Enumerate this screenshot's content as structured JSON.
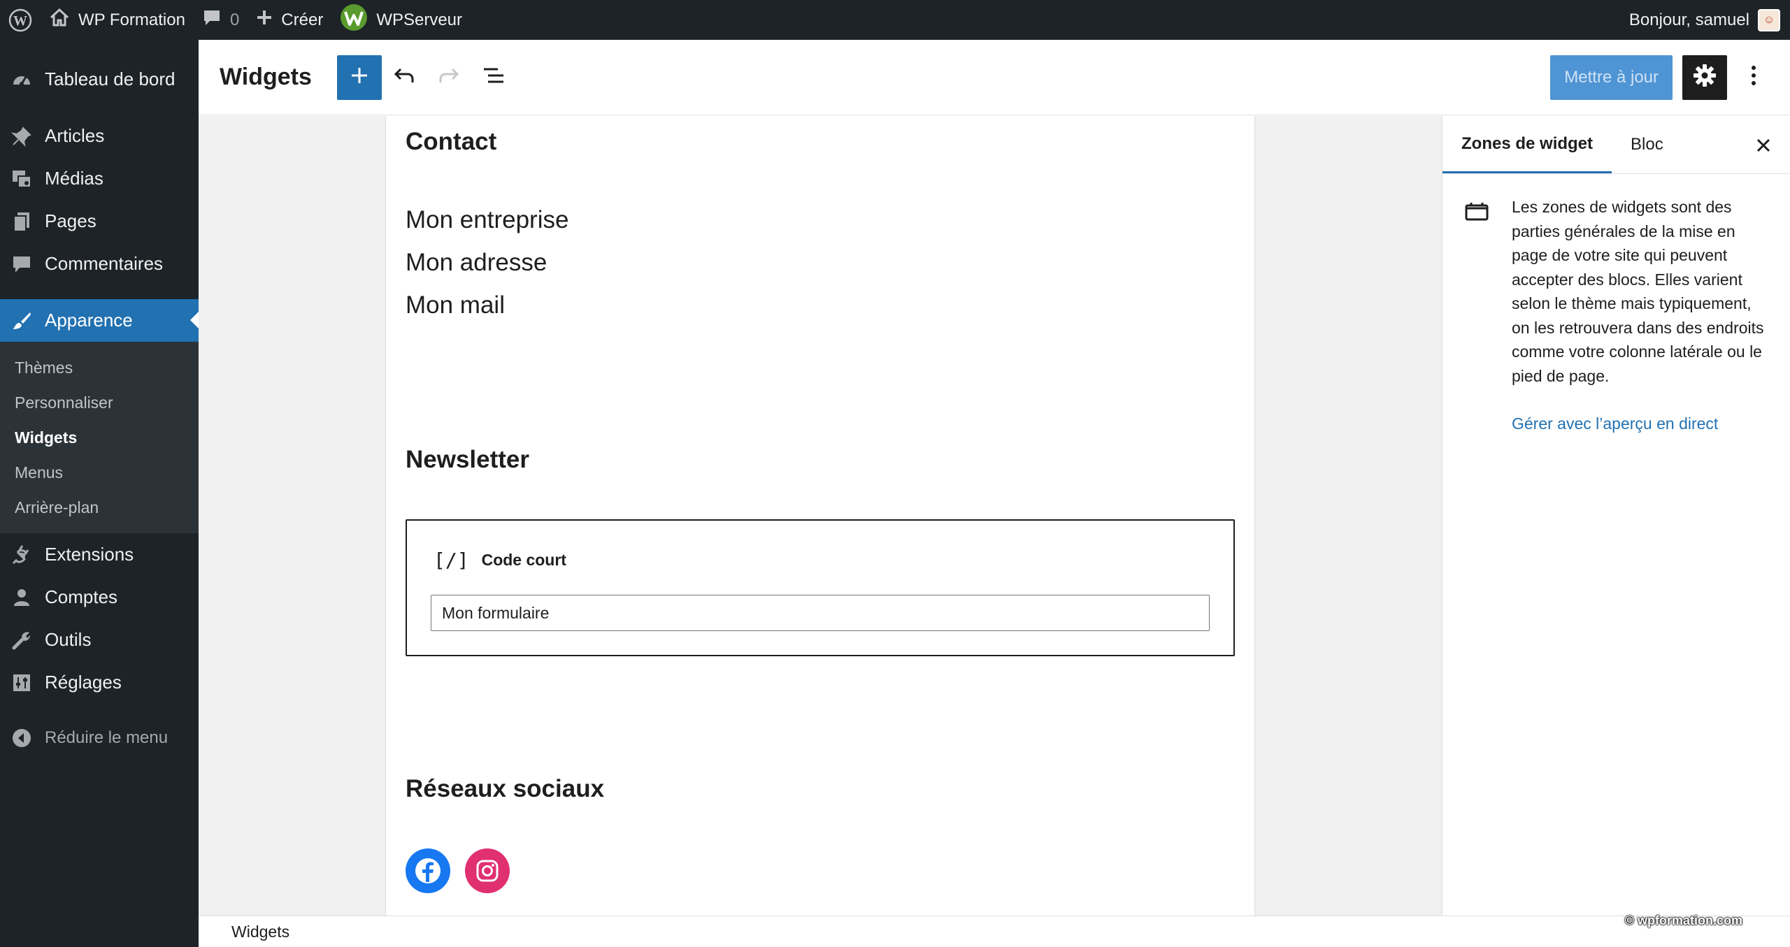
{
  "adminbar": {
    "site_name": "WP Formation",
    "comments_count": "0",
    "create_label": "Créer",
    "plugin_label": "WPServeur",
    "greeting": "Bonjour, samuel"
  },
  "sidebar": {
    "items": [
      {
        "label": "Tableau de bord",
        "icon": "dashboard-icon"
      },
      {
        "label": "Articles",
        "icon": "pin-icon"
      },
      {
        "label": "Médias",
        "icon": "media-icon"
      },
      {
        "label": "Pages",
        "icon": "pages-icon"
      },
      {
        "label": "Commentaires",
        "icon": "comment-icon"
      },
      {
        "label": "Apparence",
        "icon": "brush-icon"
      },
      {
        "label": "Extensions",
        "icon": "plugin-icon"
      },
      {
        "label": "Comptes",
        "icon": "user-icon"
      },
      {
        "label": "Outils",
        "icon": "wrench-icon"
      },
      {
        "label": "Réglages",
        "icon": "settings-sliders-icon"
      }
    ],
    "submenu": [
      "Thèmes",
      "Personnaliser",
      "Widgets",
      "Menus",
      "Arrière-plan"
    ],
    "collapse_label": "Réduire le menu"
  },
  "header": {
    "title": "Widgets",
    "update_label": "Mettre à jour"
  },
  "canvas": {
    "contact_heading": "Contact",
    "contact_lines": [
      "Mon entreprise",
      "Mon adresse",
      "Mon mail"
    ],
    "newsletter_heading": "Newsletter",
    "shortcode_label": "Code court",
    "shortcode_icon": "[/]",
    "shortcode_value": "Mon formulaire",
    "social_heading": "Réseaux sociaux",
    "social_icons": [
      "facebook-icon",
      "instagram-icon"
    ]
  },
  "panel": {
    "tabs": [
      "Zones de widget",
      "Bloc"
    ],
    "description": "Les zones de widgets sont des parties générales de la mise en page de votre site qui peuvent accepter des blocs. Elles varient selon le thème mais typiquement, on les retrouvera dans des endroits comme votre colonne latérale ou le pied de page.",
    "link": "Gérer avec l’aperçu en direct"
  },
  "footer": {
    "breadcrumb": "Widgets",
    "watermark": "© wpformation.com"
  },
  "colors": {
    "admin_dark": "#1d2327",
    "accent": "#2271b1",
    "facebook": "#1778f2",
    "instagram": "#e0306f"
  }
}
